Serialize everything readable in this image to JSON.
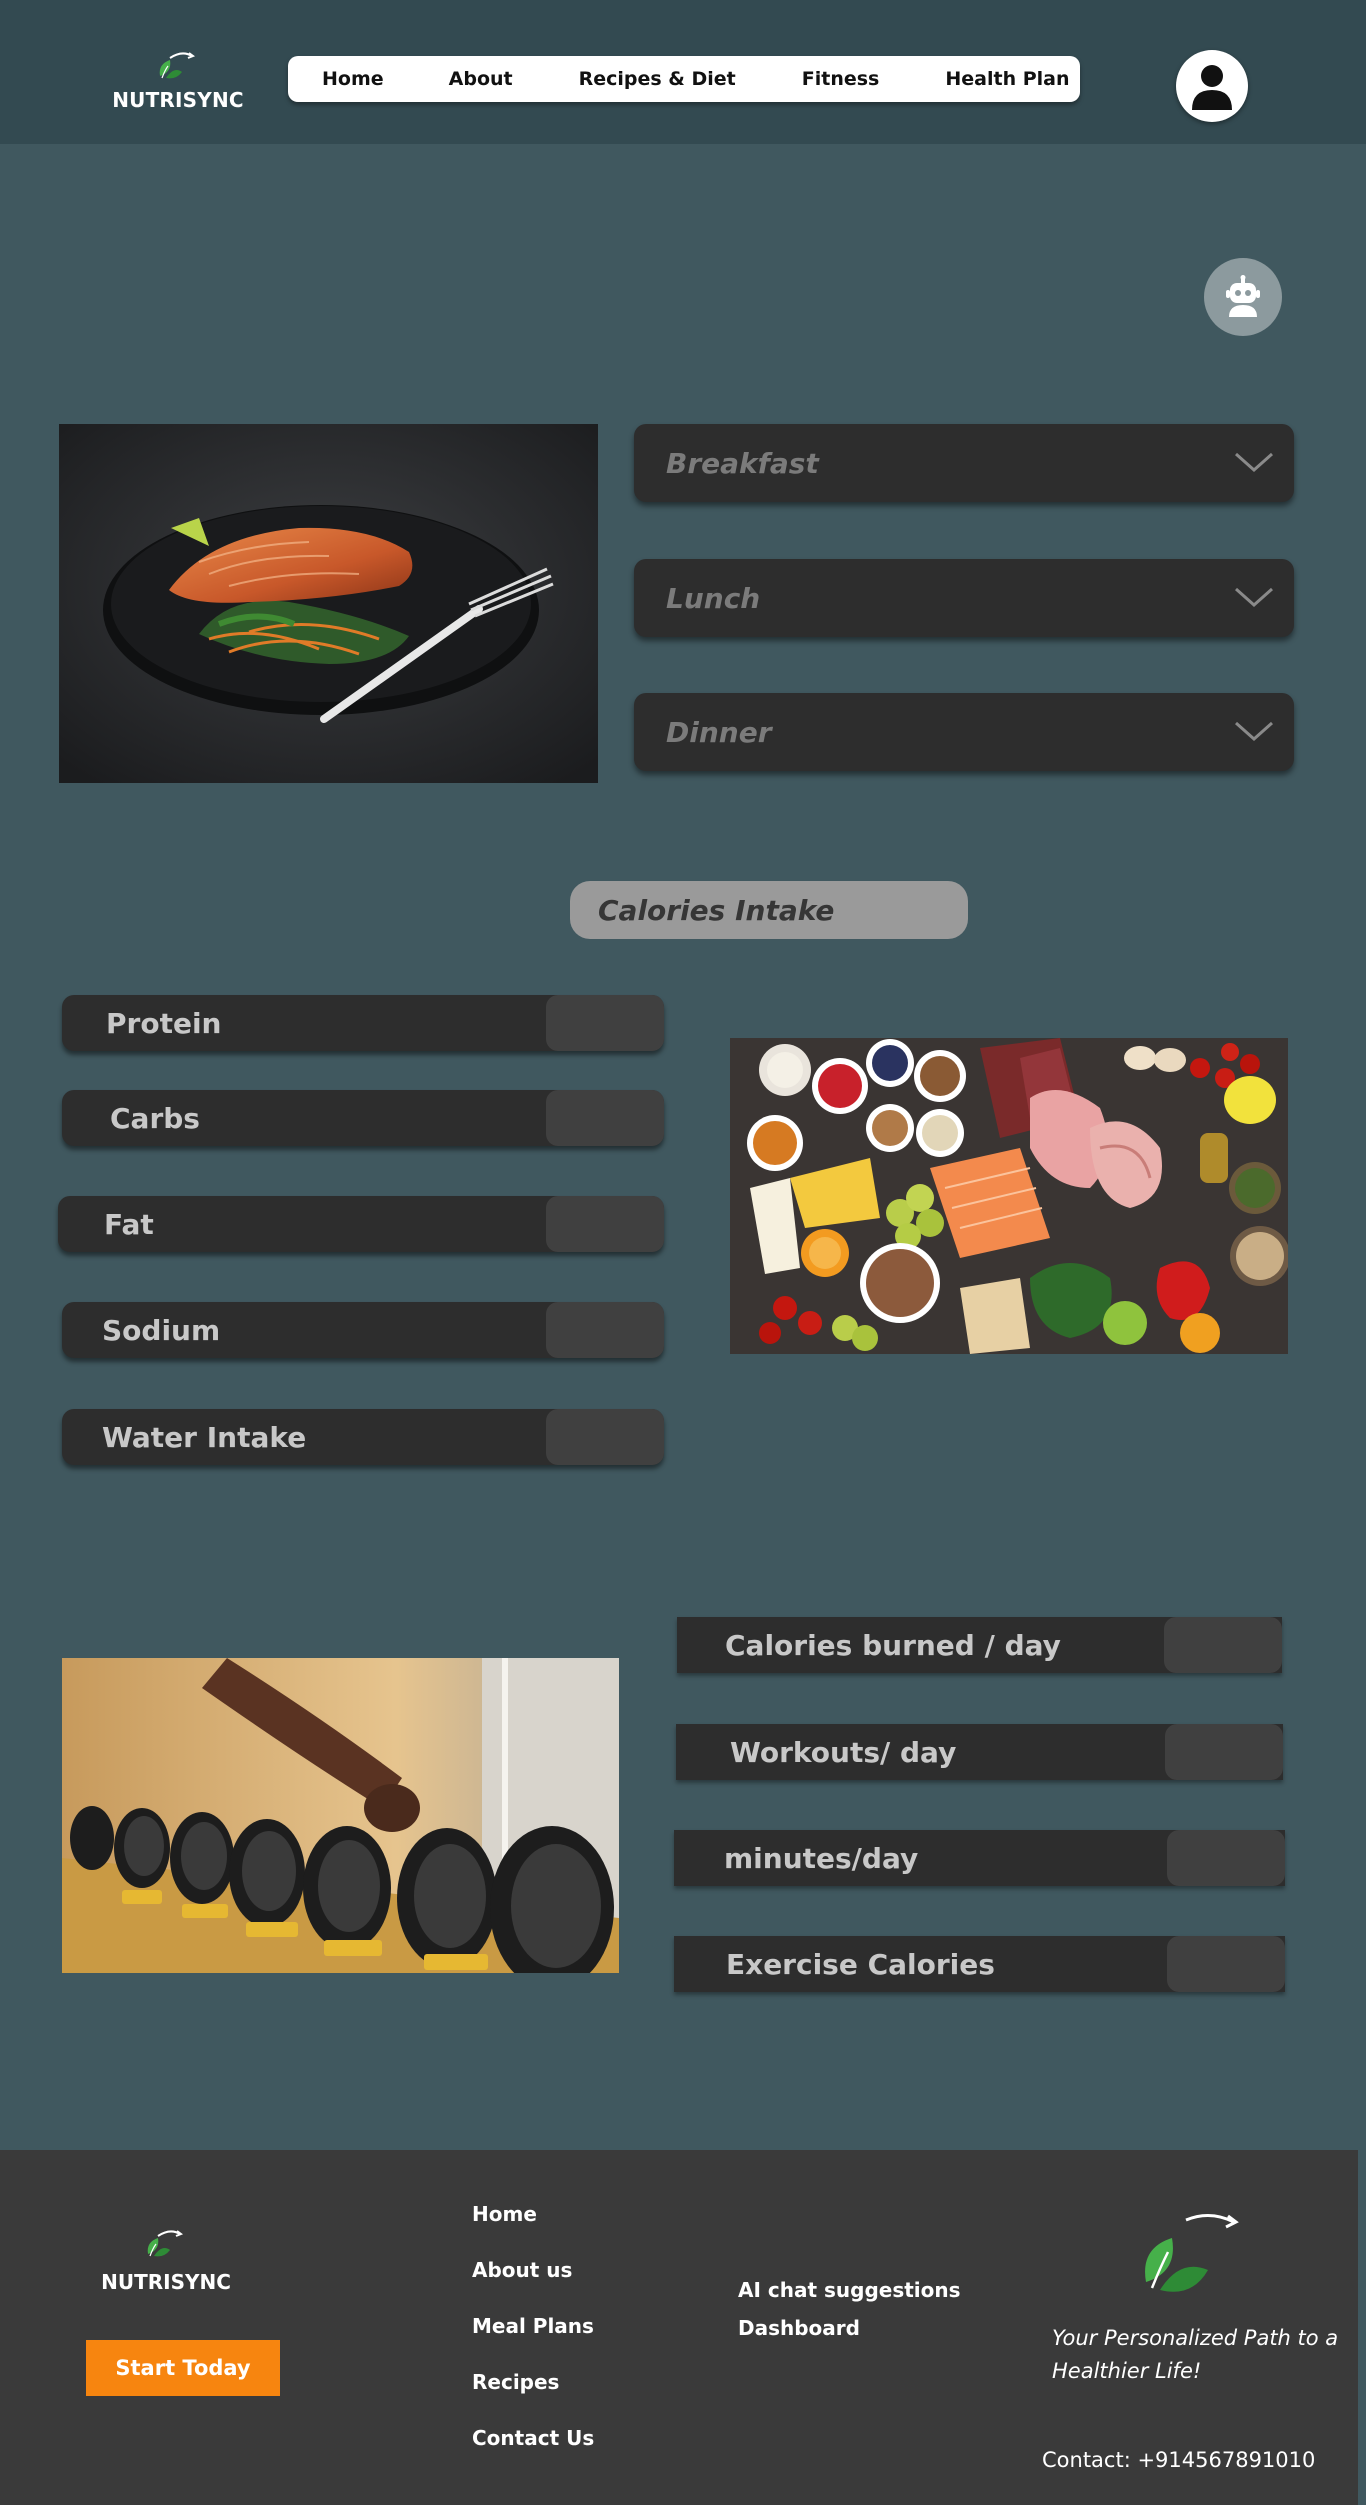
{
  "brand": {
    "name": "NUTRISYNC"
  },
  "nav": {
    "items": [
      "Home",
      "About",
      "Recipes & Diet",
      "Fitness",
      "Health Plan"
    ]
  },
  "meals": [
    "Breakfast",
    "Lunch",
    "Dinner"
  ],
  "calories_intake": {
    "title": "Calories Intake",
    "items": [
      "Protein",
      "Carbs",
      "Fat",
      "Sodium",
      "Water Intake"
    ]
  },
  "exercise": {
    "items": [
      "Calories burned / day",
      "Workouts/ day",
      "minutes/day",
      "Exercise Calories"
    ]
  },
  "footer": {
    "brand": "NUTRISYNC",
    "cta": "Start Today",
    "links": [
      "Home",
      "About us",
      "Meal Plans",
      "Recipes",
      "Contact Us"
    ],
    "links2": [
      "AI chat suggestions",
      "Dashboard"
    ],
    "tagline": "Your Personalized Path to a Healthier Life!",
    "contact": "Contact: +914567891010"
  },
  "icons": {
    "logo": "leaf-logo-icon",
    "avatar": "user-icon",
    "assistant": "robot-icon",
    "dropdown": "chevron-down-icon"
  },
  "colors": {
    "page_bg": "#40585f",
    "header_bg": "#334a51",
    "panel": "#2d2d2d",
    "accent": "#f7850f",
    "footer_bg": "#3a3a3a"
  }
}
